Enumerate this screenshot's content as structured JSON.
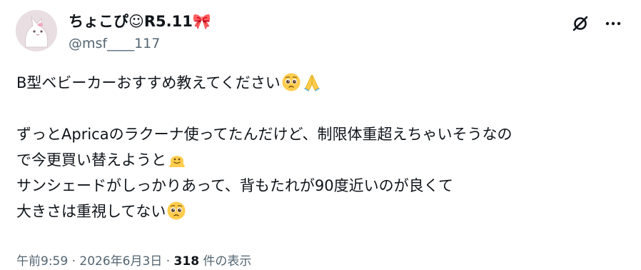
{
  "author": {
    "display_name": "ちょこぴ☺R5.11",
    "name_emoji": "🎀",
    "handle": "@msf____117"
  },
  "actions": {
    "grok_icon": "grok-icon",
    "more_icon": "more-icon"
  },
  "tweet": {
    "line1": "B型ベビーカーおすすめ教えてください",
    "line2": "ずっとApricaのラクーナ使ってたんだけど、制限体重超えちゃいそうなの",
    "line3": "で今更買い替えようと",
    "line4": "サンシェードがしっかりあって、背もたれが90度近いのが良くて",
    "line5": "大きさは重視してない",
    "emojis": [
      "pleading-face",
      "folded-hands",
      "melting-face",
      "pleading-face"
    ]
  },
  "meta": {
    "time": "午前9:59",
    "separator": "·",
    "date": "2026年6月3日",
    "views_count": "318",
    "views_label": "件の表示"
  },
  "colors": {
    "text": "#0f1419",
    "secondary": "#536471",
    "emoji_yellow": "#ffcc4d"
  }
}
